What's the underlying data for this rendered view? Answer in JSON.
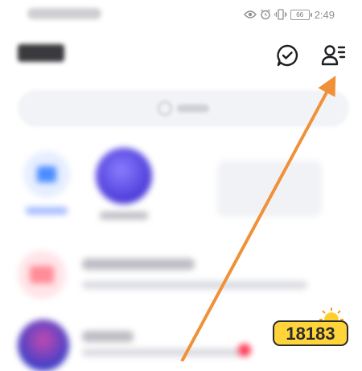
{
  "status_bar": {
    "carrier": "",
    "time": "2:49",
    "battery_level": "66",
    "icons": [
      "eye-icon",
      "alarm-icon",
      "vibrate-icon",
      "battery-icon"
    ]
  },
  "header": {
    "title": "",
    "actions": [
      {
        "name": "chat-check-button",
        "icon": "chat-check-icon"
      },
      {
        "name": "contacts-button",
        "icon": "person-list-icon"
      }
    ]
  },
  "search": {
    "placeholder": ""
  },
  "shortcuts": [
    {
      "label": "",
      "icon": "home-icon",
      "accent": "#4a8cff"
    },
    {
      "label": "",
      "icon": "app-icon",
      "accent": "#5b5cf0"
    }
  ],
  "list": [
    {
      "title": "",
      "subtitle": "",
      "icon": "mail-icon",
      "accent": "#ff5a6a"
    },
    {
      "title": "",
      "subtitle": "",
      "icon": "avatar",
      "accent": "#6a5be6",
      "badge_color": "#ff3b55"
    }
  ],
  "annotation": {
    "arrow_color": "#f0913a",
    "target": "contacts-button"
  },
  "watermark": {
    "text": "18183"
  }
}
